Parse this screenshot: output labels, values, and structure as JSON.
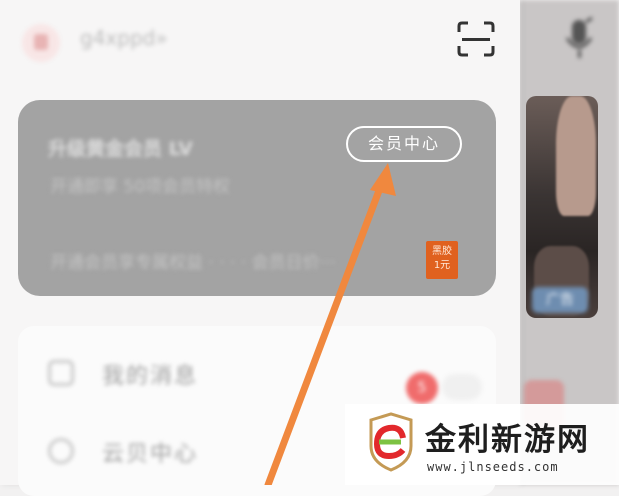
{
  "app": {
    "username": "g4xppd»",
    "vip_card": {
      "title": "升级黄金会员 LV",
      "subtitle": "开通即享 50项会员特权",
      "bottom_text": "开通会员享专属权益 · · · · 会员日价···",
      "center_button": "会员中心",
      "badge_line1": "黑胶",
      "badge_line2": "1元"
    },
    "menu": [
      {
        "label": "我的消息",
        "icon": "message-icon",
        "badge": "5"
      },
      {
        "label": "云贝中心",
        "icon": "coin-icon"
      }
    ],
    "behind": {
      "ad_tag": "广告"
    },
    "watermark": {
      "name": "金利新游网",
      "url": "www.jlnseeds.com"
    }
  },
  "colors": {
    "accent_arrow": "#f0883e",
    "card_bg": "#a3a3a3",
    "badge": "#e0611f",
    "red_dot": "#f06c6c"
  }
}
